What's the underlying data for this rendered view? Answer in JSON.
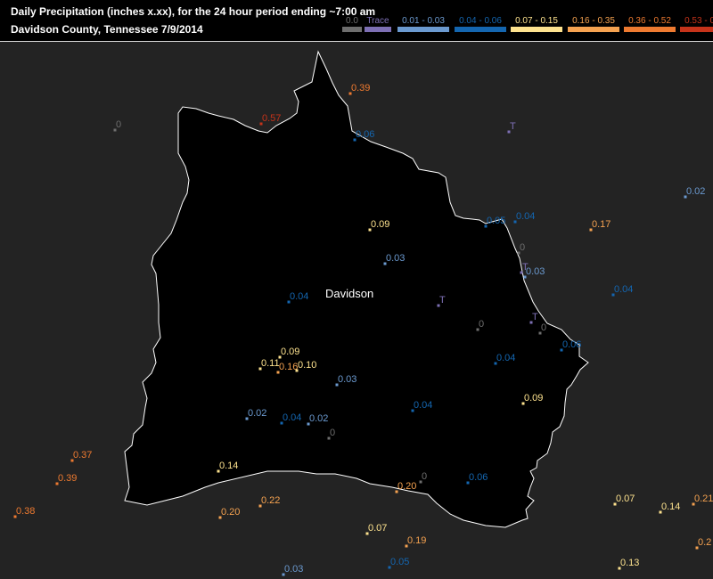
{
  "header": {
    "title": "Daily Precipitation (inches  x.xx),  for the 24 hour period ending ~7:00 am",
    "subtitle": "Davidson County, Tennessee  7/9/2014"
  },
  "legend": [
    {
      "label": "0.0",
      "color": "#6e6e6e"
    },
    {
      "label": "Trace",
      "color": "#7d6fb4"
    },
    {
      "label": "0.01 - 0.03",
      "color": "#6b9ad0"
    },
    {
      "label": "0.04 - 0.06",
      "color": "#1466b0"
    },
    {
      "label": "0.07 - 0.15",
      "color": "#fde28e"
    },
    {
      "label": "0.16 - 0.35",
      "color": "#f5a250"
    },
    {
      "label": "0.36 - 0.52",
      "color": "#ee7a30"
    },
    {
      "label": "0.53 - 0.57",
      "color": "#c5331a"
    }
  ],
  "map": {
    "county_label": "Davidson",
    "background_color": "#232323",
    "county_fill": "#000000",
    "boundary_color": "#ffffff"
  },
  "stations": [
    {
      "label": "0.39",
      "color": "#ee7a30"
    },
    {
      "label": "0.57",
      "color": "#c5331a"
    },
    {
      "label": "0",
      "color": "#6e6e6e"
    },
    {
      "label": "0.06",
      "color": "#1466b0"
    },
    {
      "label": "T",
      "color": "#7d6fb4"
    },
    {
      "label": "0.02",
      "color": "#6b9ad0"
    },
    {
      "label": "0.09",
      "color": "#fde28e"
    },
    {
      "label": "0.05",
      "color": "#1466b0"
    },
    {
      "label": "0.04",
      "color": "#1466b0"
    },
    {
      "label": "0.17",
      "color": "#f5a250"
    },
    {
      "label": "0",
      "color": "#6e6e6e"
    },
    {
      "label": "0.03",
      "color": "#6b9ad0"
    },
    {
      "label": "T",
      "color": "#7d6fb4"
    },
    {
      "label": "0.03",
      "color": "#6b9ad0"
    },
    {
      "label": "0.04",
      "color": "#1466b0"
    },
    {
      "label": "0.04",
      "color": "#1466b0"
    },
    {
      "label": "T",
      "color": "#7d6fb4"
    },
    {
      "label": "T",
      "color": "#7d6fb4"
    },
    {
      "label": "0",
      "color": "#6e6e6e"
    },
    {
      "label": "0",
      "color": "#6e6e6e"
    },
    {
      "label": "0.06",
      "color": "#1466b0"
    },
    {
      "label": "0.09",
      "color": "#fde28e"
    },
    {
      "label": "0.11",
      "color": "#fde28e"
    },
    {
      "label": "0.16",
      "color": "#f5a250"
    },
    {
      "label": "0.10",
      "color": "#fde28e"
    },
    {
      "label": "0.04",
      "color": "#1466b0"
    },
    {
      "label": "0.03",
      "color": "#6b9ad0"
    },
    {
      "label": "0.09",
      "color": "#fde28e"
    },
    {
      "label": "0.04",
      "color": "#1466b0"
    },
    {
      "label": "0.02",
      "color": "#6b9ad0"
    },
    {
      "label": "0.04",
      "color": "#1466b0"
    },
    {
      "label": "0.02",
      "color": "#6b9ad0"
    },
    {
      "label": "0",
      "color": "#6e6e6e"
    },
    {
      "label": "0.37",
      "color": "#ee7a30"
    },
    {
      "label": "0.39",
      "color": "#ee7a30"
    },
    {
      "label": "0.38",
      "color": "#ee7a30"
    },
    {
      "label": "0.14",
      "color": "#fde28e"
    },
    {
      "label": "0.20",
      "color": "#f5a250"
    },
    {
      "label": "0",
      "color": "#6e6e6e"
    },
    {
      "label": "0.06",
      "color": "#1466b0"
    },
    {
      "label": "0.22",
      "color": "#f5a250"
    },
    {
      "label": "0.20",
      "color": "#f5a250"
    },
    {
      "label": "0.07",
      "color": "#fde28e"
    },
    {
      "label": "0.19",
      "color": "#f5a250"
    },
    {
      "label": "0.05",
      "color": "#1466b0"
    },
    {
      "label": "0.03",
      "color": "#6b9ad0"
    },
    {
      "label": "0.07",
      "color": "#fde28e"
    },
    {
      "label": "0.14",
      "color": "#fde28e"
    },
    {
      "label": "0.21",
      "color": "#f5a250"
    },
    {
      "label": "0.2",
      "color": "#f5a250"
    },
    {
      "label": "0.13",
      "color": "#fde28e"
    }
  ]
}
